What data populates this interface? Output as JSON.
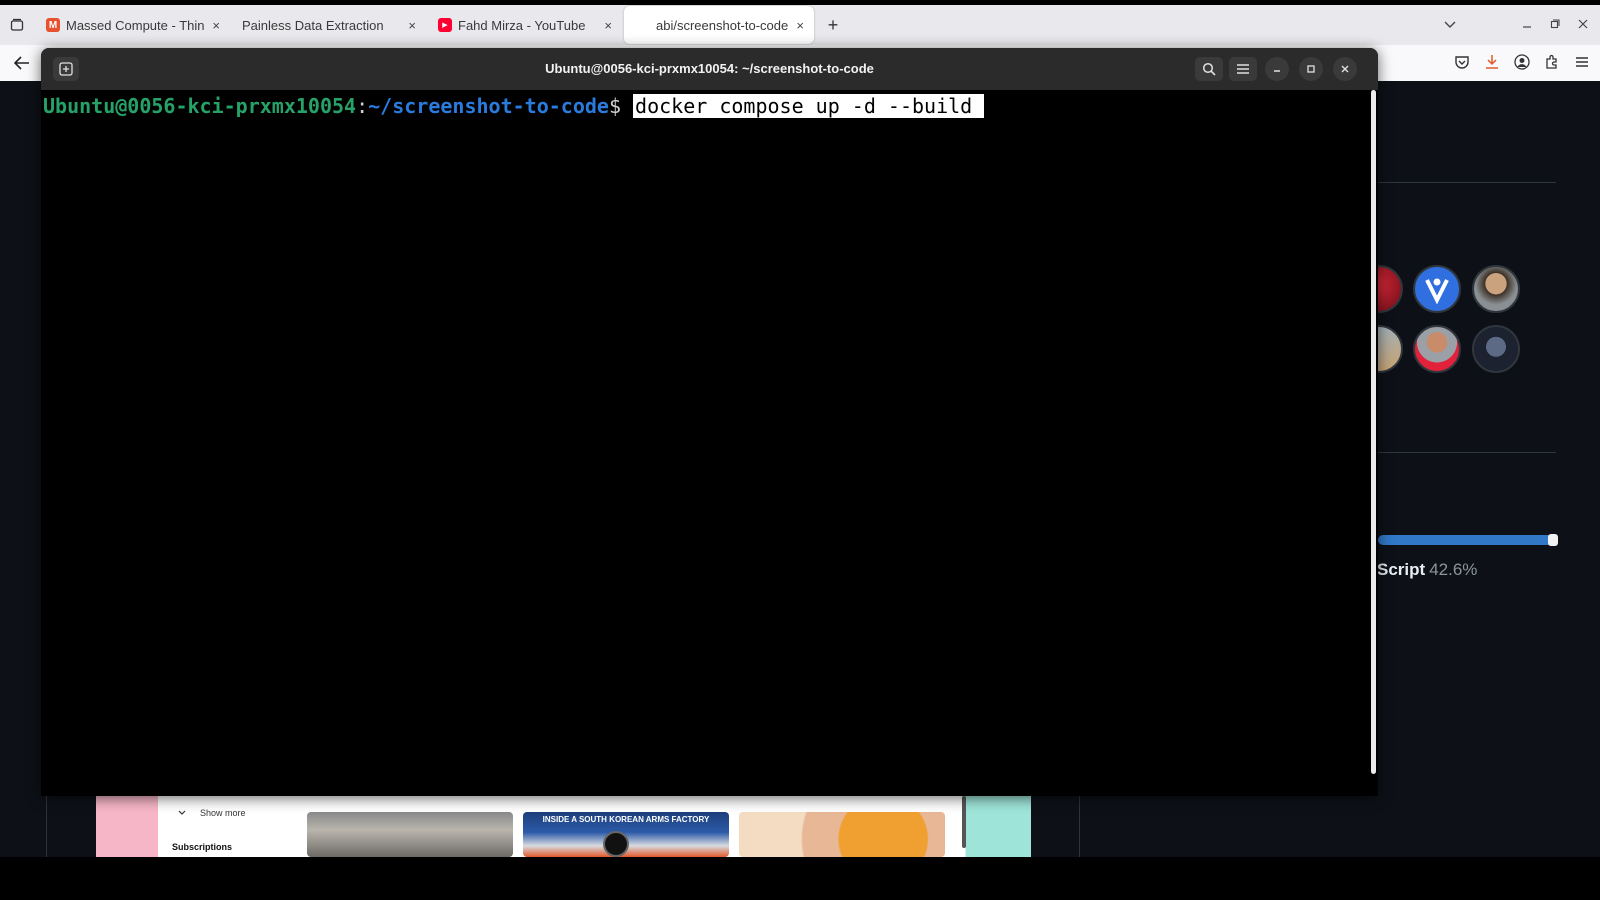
{
  "browser": {
    "tabs": [
      {
        "title": "Massed Compute - Think",
        "favicon_color": "#e8512f",
        "favicon": "M"
      },
      {
        "title": "Painless Data Extraction",
        "favicon_color": "",
        "favicon": ""
      },
      {
        "title": "Fahd Mirza - YouTube",
        "favicon_color": "#ff0033",
        "favicon": "▶"
      },
      {
        "title": "abi/screenshot-to-code:",
        "favicon_color": "",
        "favicon": ""
      }
    ],
    "new_tab_label": "+",
    "close_label": "×"
  },
  "terminal": {
    "title": "Ubuntu@0056-kci-prxmx10054: ~/screenshot-to-code",
    "prompt_user": "Ubuntu@0056-kci-prxmx10054",
    "prompt_colon": ":",
    "prompt_path": "~/screenshot-to-code",
    "prompt_symbol": "$ ",
    "command": "docker compose up -d --build"
  },
  "background_page": {
    "language_name": "Script",
    "language_percent": "42.6%"
  },
  "youtube_strip": {
    "show_more": "Show more",
    "subscriptions": "Subscriptions",
    "thumb2_caption": "INSIDE A SOUTH KOREAN ARMS FACTORY"
  },
  "colors": {
    "prompt_user": "#26a269",
    "prompt_path": "#2a7bde",
    "terminal_bg": "#000000",
    "terminal_header": "#2b2b2b",
    "lang_bar": "#3178c6"
  }
}
